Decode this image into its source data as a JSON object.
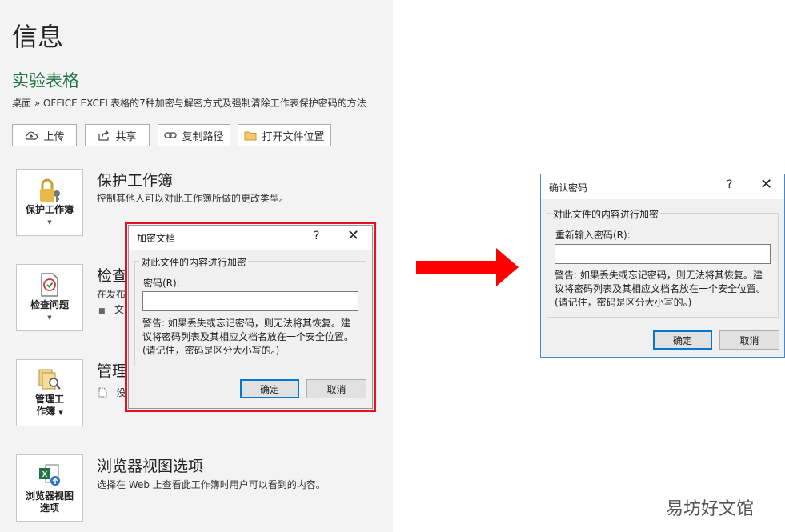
{
  "info_page": {
    "title": "信息",
    "doc_name": "实验表格",
    "breadcrumb": "桌面 » OFFICE EXCEL表格的7种加密与解密方式及强制清除工作表保护密码的方法",
    "toolbar": {
      "upload": "上传",
      "share": "共享",
      "copy_path": "复制路径",
      "open_location": "打开文件位置"
    },
    "sections": {
      "protect": {
        "button": "保护工作簿",
        "title": "保护工作簿",
        "desc": "控制其他人可以对此工作簿所做的更改类型。"
      },
      "inspect": {
        "button": "检查问题",
        "title_partial": "检查",
        "desc_partial": "在发布",
        "bullet_partial": "文"
      },
      "manage": {
        "button_line1": "管理工",
        "button_line2": "作簿",
        "title_partial": "管理",
        "item_partial": "没"
      },
      "browser": {
        "button_line1": "浏览器视图",
        "button_line2": "选项",
        "title": "浏览器视图选项",
        "desc": "选择在 Web 上查看此工作簿时用户可以看到的内容。"
      }
    }
  },
  "encrypt_dialog": {
    "title": "加密文档",
    "help": "?",
    "close": "✕",
    "group_label": "对此文件的内容进行加密",
    "password_label": "密码(R):",
    "password_value": "",
    "warning": [
      "警告: 如果丢失或忘记密码，则无法将其恢复。建",
      "议将密码列表及其相应文档名放在一个安全位置。",
      "(请记住，密码是区分大小写的。)"
    ],
    "ok": "确定",
    "cancel": "取消"
  },
  "confirm_dialog": {
    "title": "确认密码",
    "help": "?",
    "close": "✕",
    "group_label": "对此文件的内容进行加密",
    "password_label": "重新输入密码(R):",
    "password_value": "",
    "warning": [
      "警告: 如果丢失或忘记密码，则无法将其恢复。建",
      "议将密码列表及其相应文档名放在一个安全位置。",
      "(请记住，密码是区分大小写的。)"
    ],
    "ok": "确定",
    "cancel": "取消"
  },
  "watermark": "易坊好文馆",
  "colors": {
    "doc_name": "#217346",
    "highlight_border": "#e81123",
    "arrow": "#ff0000",
    "primary_button_border": "#0078d7",
    "dialog_border": "#0078d7"
  }
}
